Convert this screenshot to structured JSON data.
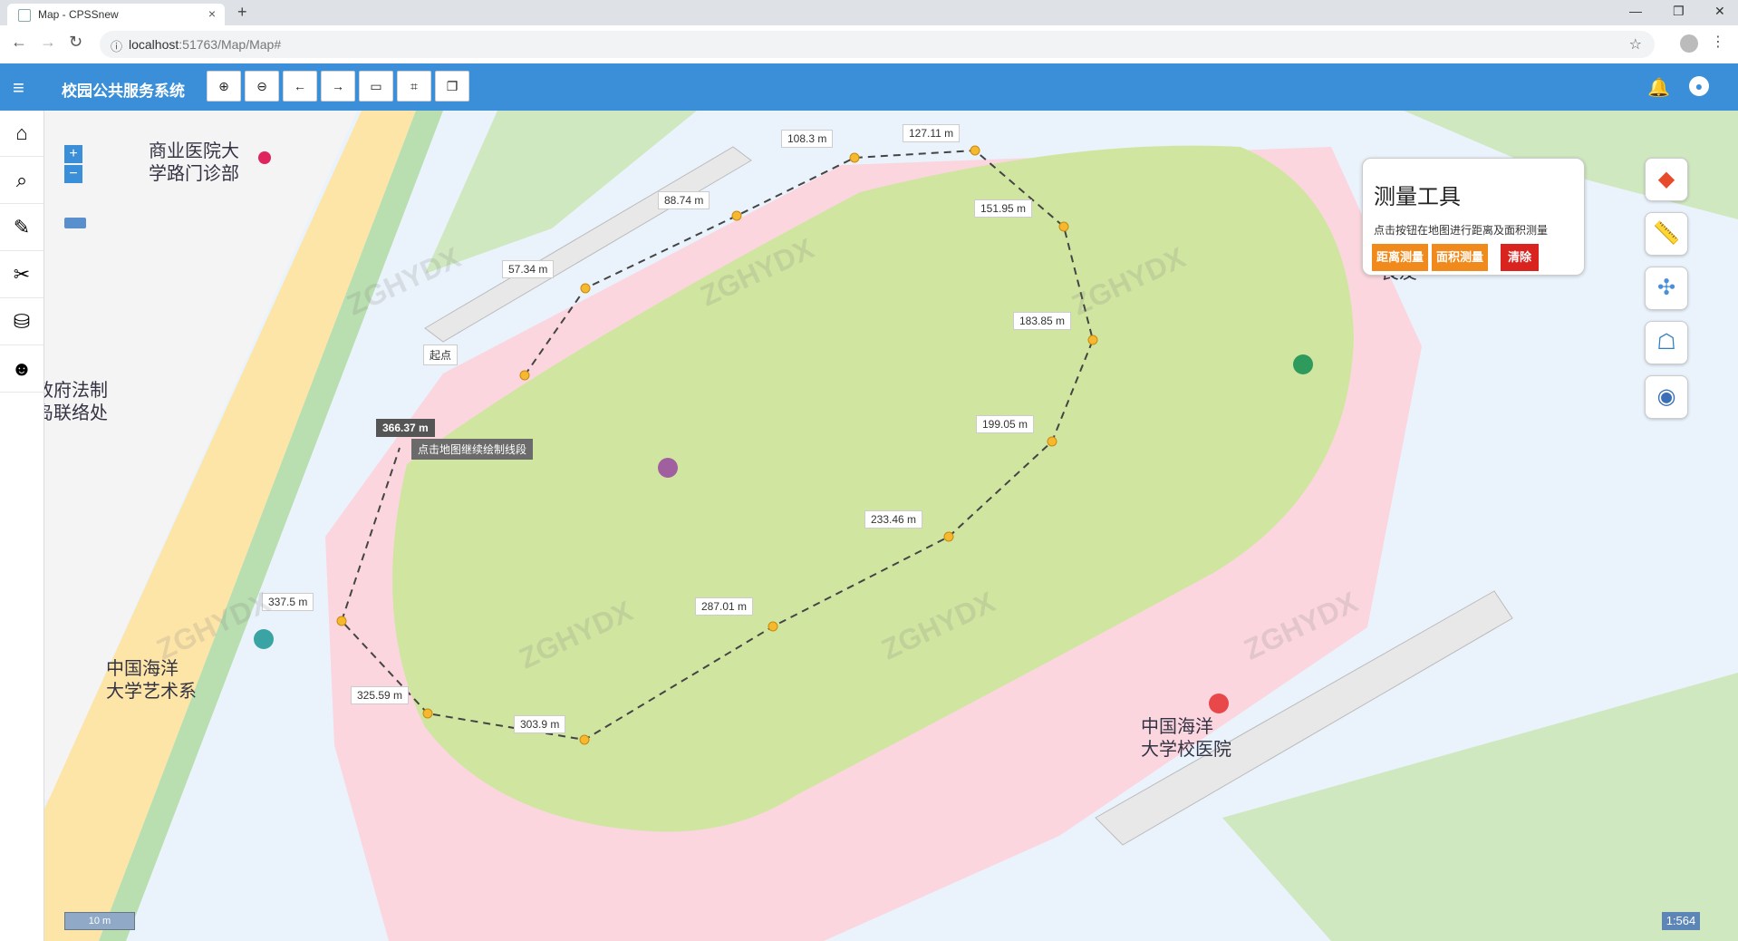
{
  "browser": {
    "tab_title": "Map - CPSSnew",
    "url_host": "localhost",
    "url_rest": ":51763/Map/Map#",
    "back_icon": "←",
    "forward_icon": "→",
    "reload_icon": "↻",
    "star_icon": "☆",
    "menu_icon": "⋮",
    "info_icon": "ⓘ",
    "close_tab": "×",
    "new_tab": "+",
    "minimize": "—",
    "restore": "❐",
    "close_window": "✕"
  },
  "app": {
    "title": "校园公共服务系统",
    "hamburger_icon": "≡",
    "bell_icon": "🔔",
    "user_icon": "●",
    "toolbar": [
      {
        "name": "zoom-in-tool",
        "glyph": "⊕"
      },
      {
        "name": "zoom-out-tool",
        "glyph": "⊖"
      },
      {
        "name": "back-tool",
        "glyph": "←"
      },
      {
        "name": "forward-tool",
        "glyph": "→"
      },
      {
        "name": "map-tool",
        "glyph": "▭"
      },
      {
        "name": "crop-tool",
        "glyph": "⌗"
      },
      {
        "name": "copy-tool",
        "glyph": "❐"
      }
    ],
    "sidebar": [
      {
        "name": "home-icon",
        "glyph": "⌂"
      },
      {
        "name": "search-icon",
        "glyph": "⌕"
      },
      {
        "name": "edit-icon",
        "glyph": "✎"
      },
      {
        "name": "tools-icon",
        "glyph": "✂"
      },
      {
        "name": "database-icon",
        "glyph": "⛁"
      },
      {
        "name": "person-icon",
        "glyph": "☻"
      }
    ]
  },
  "map": {
    "zoom_in": "+",
    "zoom_out": "−",
    "scale_bar": "10 m",
    "scale_ratio": "1:564",
    "watermark": "ZGHYDX",
    "pois": [
      {
        "id": "poi-hospital-gate",
        "lines": [
          "商业医院大",
          "学路门诊部"
        ]
      },
      {
        "id": "poi-govt-office",
        "lines": [
          "政府法制",
          "岛联络处"
        ]
      },
      {
        "id": "poi-art-dept",
        "lines": [
          "中国海洋",
          "大学艺术系"
        ]
      },
      {
        "id": "poi-campus-hospital",
        "lines": [
          "中国海洋",
          "大学校医院"
        ]
      },
      {
        "id": "poi-partial-right",
        "lines": [
          "良友"
        ]
      }
    ],
    "measure_labels": [
      "起点",
      "57.34 m",
      "88.74 m",
      "108.3 m",
      "127.11 m",
      "151.95 m",
      "183.85 m",
      "199.05 m",
      "233.46 m",
      "287.01 m",
      "303.9 m",
      "325.59 m",
      "337.5 m"
    ],
    "current_total": "366.37 m",
    "hint": "点击地图继续绘制线段"
  },
  "measure_panel": {
    "title": "测量工具",
    "description": "点击按钮在地图进行距离及面积测量",
    "distance_button": "距离测量",
    "area_button": "面积测量",
    "clear_button": "清除",
    "colors": {
      "orange": "#f08a1c",
      "red": "#d9231f"
    }
  },
  "right_tools": [
    {
      "name": "layers-icon",
      "glyph": "◆"
    },
    {
      "name": "ruler-icon",
      "glyph": "📏"
    },
    {
      "name": "network-icon",
      "glyph": "✣"
    },
    {
      "name": "robot-icon",
      "glyph": "☖"
    },
    {
      "name": "globe-search-icon",
      "glyph": "◉"
    }
  ]
}
